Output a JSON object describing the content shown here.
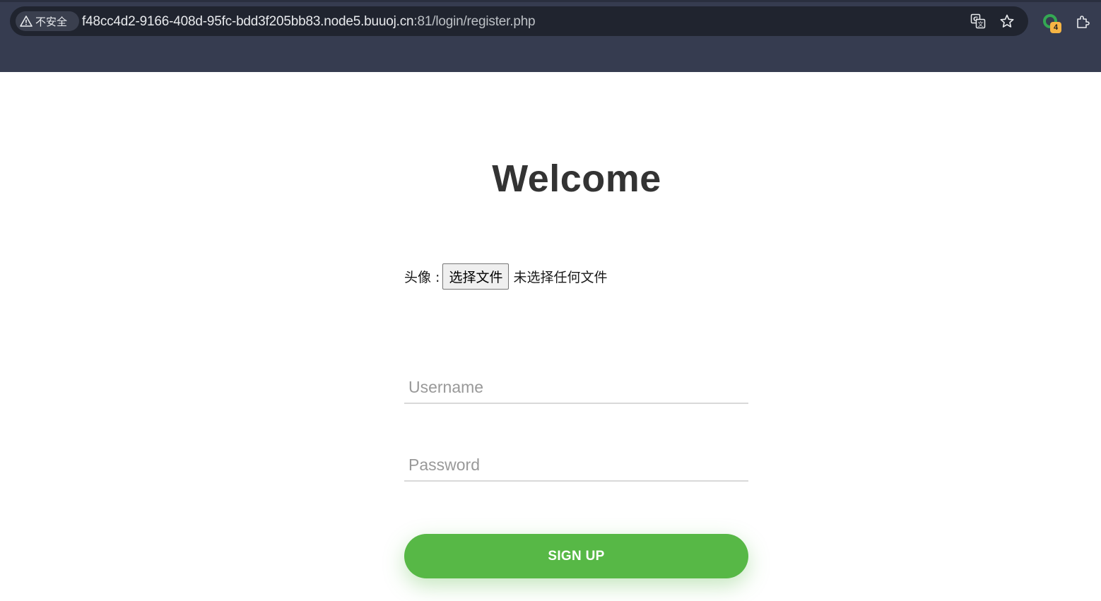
{
  "browser": {
    "security_label": "不安全",
    "url_host": "f48cc4d2-9166-408d-95fc-bdd3f205bb83.node5.buuoj.cn",
    "url_port_path": ":81/login/register.php",
    "extension_badge": "4",
    "icons": [
      "warning-icon",
      "translate-icon",
      "star-icon",
      "extension-ring-icon",
      "puzzle-icon"
    ]
  },
  "page": {
    "title": "Welcome",
    "avatar_label": "头像 :",
    "file_button_label": "选择文件",
    "file_status": "未选择任何文件",
    "username_placeholder": "Username",
    "password_placeholder": "Password",
    "signup_label": "SIGN UP",
    "accent_color": "#57b846"
  }
}
